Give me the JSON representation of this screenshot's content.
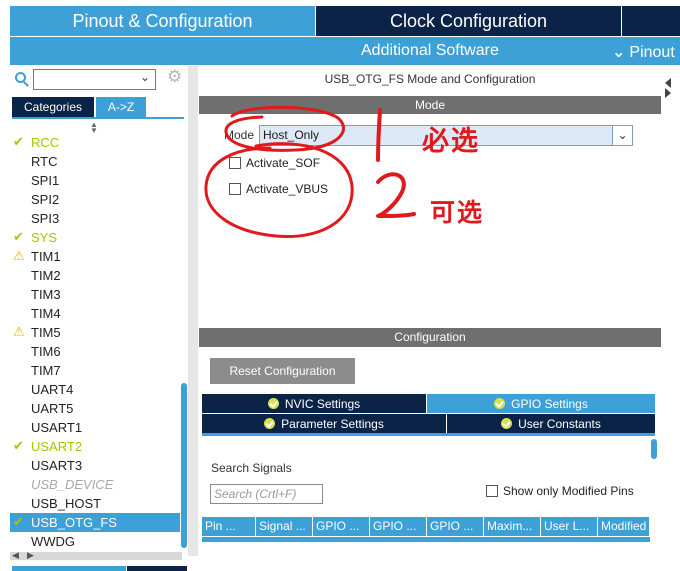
{
  "top_tabs": {
    "pinout": "Pinout & Configuration",
    "clock": "Clock Configuration"
  },
  "sub_bar": {
    "additional_software": "Additional Software",
    "pinout": "Pinout",
    "pinout_chevron": "chevron-down-icon"
  },
  "left_panel": {
    "search_value": "",
    "filter_tabs": [
      "Categories",
      "A->Z"
    ],
    "active_filter": "A->Z",
    "peripherals": [
      {
        "label": "RCC",
        "status": "ok"
      },
      {
        "label": "RTC",
        "status": "none"
      },
      {
        "label": "SPI1",
        "status": "none"
      },
      {
        "label": "SPI2",
        "status": "none"
      },
      {
        "label": "SPI3",
        "status": "none"
      },
      {
        "label": "SYS",
        "status": "ok"
      },
      {
        "label": "TIM1",
        "status": "warning"
      },
      {
        "label": "TIM2",
        "status": "none"
      },
      {
        "label": "TIM3",
        "status": "none"
      },
      {
        "label": "TIM4",
        "status": "none"
      },
      {
        "label": "TIM5",
        "status": "warning"
      },
      {
        "label": "TIM6",
        "status": "none"
      },
      {
        "label": "TIM7",
        "status": "none"
      },
      {
        "label": "UART4",
        "status": "none"
      },
      {
        "label": "UART5",
        "status": "none"
      },
      {
        "label": "USART1",
        "status": "none"
      },
      {
        "label": "USART2",
        "status": "ok"
      },
      {
        "label": "USART3",
        "status": "none"
      },
      {
        "label": "USB_DEVICE",
        "status": "disabled"
      },
      {
        "label": "USB_HOST",
        "status": "none"
      },
      {
        "label": "USB_OTG_FS",
        "status": "selected"
      },
      {
        "label": "WWDG",
        "status": "none"
      }
    ]
  },
  "mode_panel": {
    "title": "USB_OTG_FS Mode and Configuration",
    "header": "Mode",
    "mode_label": "Mode",
    "mode_value": "Host_Only",
    "options": [
      {
        "label": "Activate_SOF",
        "checked": false
      },
      {
        "label": "Activate_VBUS",
        "checked": false
      }
    ]
  },
  "annotations": {
    "note_1": "必选",
    "note_2": "可选",
    "color": "#e0191c"
  },
  "config_panel": {
    "header": "Configuration",
    "reset_label": "Reset Configuration",
    "tabs": {
      "nvic": "NVIC Settings",
      "gpio": "GPIO Settings",
      "parameter": "Parameter Settings",
      "user_constants": "User Constants"
    },
    "active_tab": "GPIO Settings",
    "search_signals_label": "Search Signals",
    "search_placeholder": "Search (Crtl+F)",
    "show_modified_label": "Show only Modified Pins",
    "columns": [
      "Pin ...",
      "Signal ...",
      "GPIO ...",
      "GPIO ...",
      "GPIO ...",
      "Maxim...",
      "User L...",
      "Modified"
    ]
  },
  "colors": {
    "accent": "#3da0d7",
    "navy": "#0b2346",
    "ok_green": "#a8c400",
    "warning": "#f0b400"
  }
}
